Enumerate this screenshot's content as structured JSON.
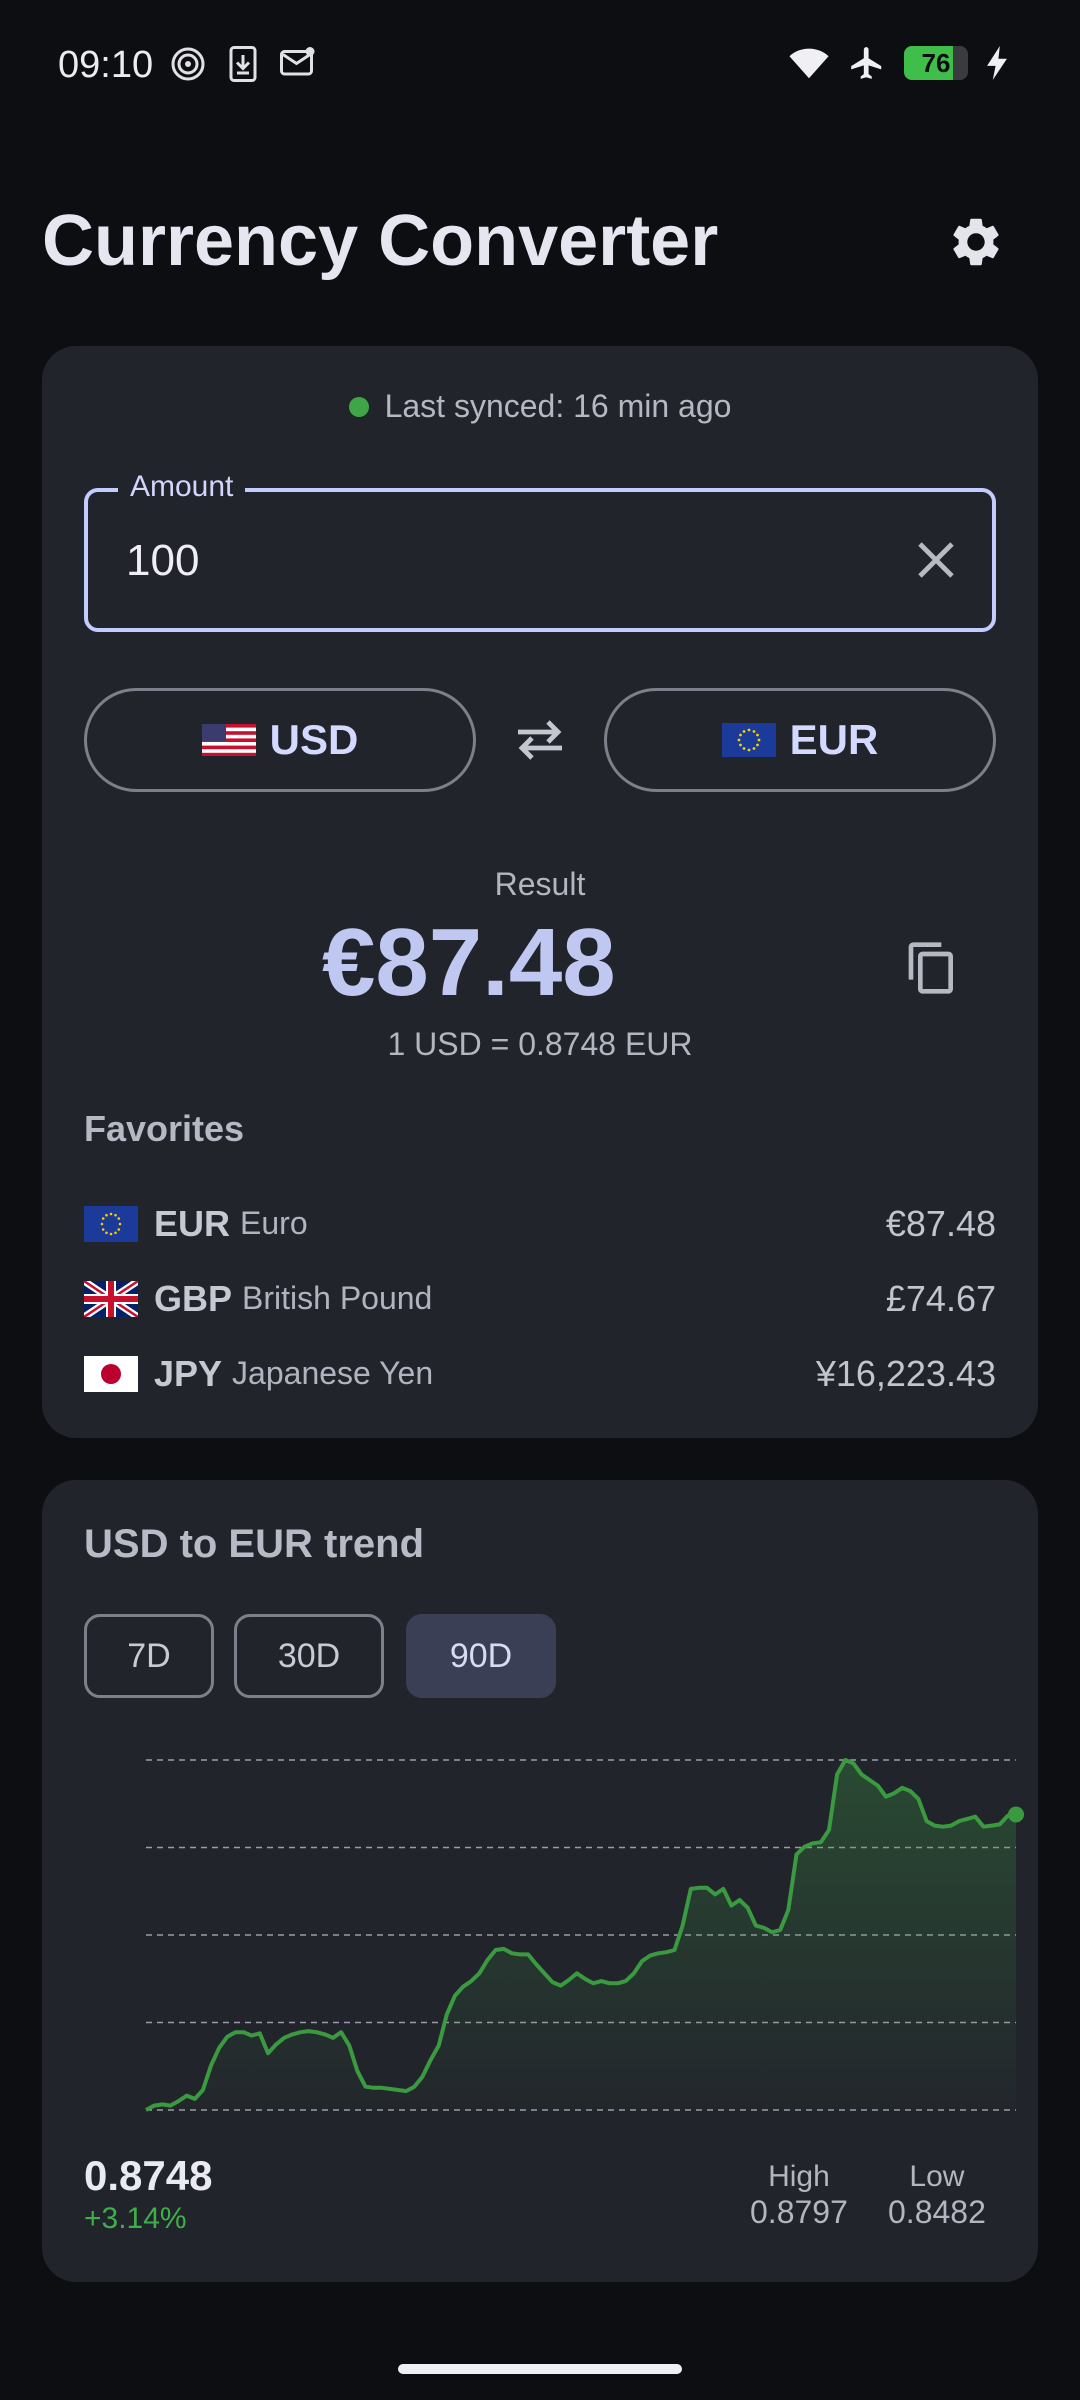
{
  "status_bar": {
    "time": "09:10",
    "battery_level": "76",
    "battery_fraction": 0.76,
    "left_icons": [
      "hotspot-spiral-icon",
      "download-phone-icon",
      "mail-notification-icon"
    ],
    "right_icons": [
      "wifi-icon",
      "airplane-mode-icon",
      "battery-icon",
      "charging-bolt-icon"
    ]
  },
  "header": {
    "title": "Currency Converter",
    "settings_icon": "gear-icon"
  },
  "converter": {
    "sync_text": "Last synced: 16 min ago",
    "amount_label": "Amount",
    "amount_value": "100",
    "from_currency": "USD",
    "to_currency": "EUR",
    "result_label": "Result",
    "result_value": "€87.48",
    "rate_text": "1 USD = 0.8748 EUR"
  },
  "favorites": {
    "title": "Favorites",
    "items": [
      {
        "code": "EUR",
        "name": "Euro",
        "amount": "€87.48",
        "flag": "eu-flag"
      },
      {
        "code": "GBP",
        "name": "British Pound",
        "amount": "£74.67",
        "flag": "uk-flag"
      },
      {
        "code": "JPY",
        "name": "Japanese Yen",
        "amount": "¥16,223.43",
        "flag": "japan-flag"
      }
    ]
  },
  "trend": {
    "title": "USD to EUR trend",
    "ranges": [
      "7D",
      "30D",
      "90D"
    ],
    "selected_range": "90D",
    "current_rate": "0.8748",
    "change": "+3.14%",
    "high_label": "High",
    "high_value": "0.8797",
    "low_label": "Low",
    "low_value": "0.8482"
  },
  "colors": {
    "background": "#0d0e12",
    "card": "#22242c",
    "accent": "#c0c8f2",
    "line": "#3a9a40",
    "positive": "#3fae49"
  },
  "chart_data": {
    "type": "area",
    "ylim": [
      0.8482,
      0.8797
    ],
    "grid": true,
    "values": [
      0.8482,
      0.8486,
      0.8487,
      0.8486,
      0.849,
      0.8495,
      0.8492,
      0.85,
      0.8522,
      0.8538,
      0.8548,
      0.8552,
      0.8552,
      0.8549,
      0.8551,
      0.8533,
      0.8541,
      0.8547,
      0.855,
      0.8552,
      0.8553,
      0.8552,
      0.855,
      0.8547,
      0.8552,
      0.854,
      0.8517,
      0.8503,
      0.8502,
      0.8502,
      0.8501,
      0.85,
      0.8499,
      0.8503,
      0.8512,
      0.8527,
      0.854,
      0.8568,
      0.8585,
      0.8593,
      0.8598,
      0.8605,
      0.8617,
      0.8626,
      0.8627,
      0.8623,
      0.8622,
      0.8622,
      0.8613,
      0.8605,
      0.8597,
      0.8594,
      0.8599,
      0.8605,
      0.86,
      0.8596,
      0.8598,
      0.8596,
      0.8596,
      0.8598,
      0.8605,
      0.8616,
      0.8621,
      0.8623,
      0.8624,
      0.8626,
      0.8648,
      0.8681,
      0.8682,
      0.8682,
      0.8676,
      0.8681,
      0.8666,
      0.8671,
      0.8664,
      0.8648,
      0.8646,
      0.8642,
      0.8644,
      0.8662,
      0.8712,
      0.8719,
      0.8722,
      0.8723,
      0.8734,
      0.8784,
      0.8797,
      0.8794,
      0.8784,
      0.8779,
      0.8774,
      0.8764,
      0.8767,
      0.8772,
      0.8769,
      0.8762,
      0.8742,
      0.8738,
      0.8737,
      0.8738,
      0.8742,
      0.8744,
      0.8746,
      0.8737,
      0.8738,
      0.8739,
      0.8747,
      0.8748
    ]
  }
}
